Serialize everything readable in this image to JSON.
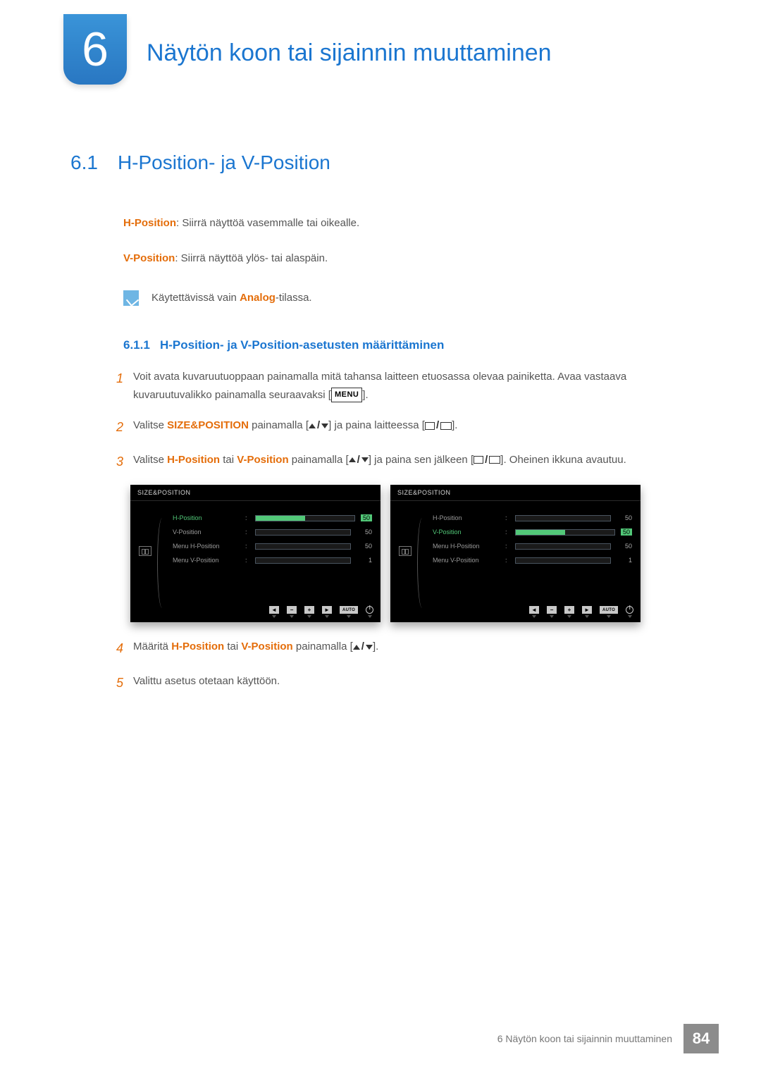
{
  "chapter": {
    "number": "6",
    "title": "Näytön koon tai sijainnin muuttaminen"
  },
  "section": {
    "number": "6.1",
    "title": "H-Position- ja V-Position"
  },
  "definitions": {
    "h_label": "H-Position",
    "h_text": ": Siirrä näyttöä vasemmalle tai oikealle.",
    "v_label": "V-Position",
    "v_text": ": Siirrä näyttöä ylös- tai alaspäin."
  },
  "note": {
    "pre": "Käytettävissä vain ",
    "word": "Analog",
    "post": "-tilassa."
  },
  "subsection": {
    "number": "6.1.1",
    "title": "H-Position- ja V-Position-asetusten määrittäminen"
  },
  "steps": {
    "s1": "Voit avata kuvaruutuoppaan painamalla mitä tahansa laitteen etuosassa olevaa painiketta. Avaa vastaava kuvaruutuvalikko painamalla seuraavaksi [",
    "s1_menu": "MENU",
    "s1_end": "].",
    "s2a": "Valitse ",
    "s2_sp": "SIZE&POSITION",
    "s2b": " painamalla [",
    "s2c": "] ja paina laitteessa [",
    "s2d": "].",
    "s3a": "Valitse ",
    "s3_h": "H-Position",
    "s3_or": " tai ",
    "s3_v": "V-Position",
    "s3b": " painamalla [",
    "s3c": "] ja paina sen jälkeen [",
    "s3d": "]. Oheinen ikkuna avautuu.",
    "s4a": "Määritä ",
    "s4_h": "H-Position",
    "s4_or": " tai ",
    "s4_v": "V-Position",
    "s4b": " painamalla [",
    "s4c": "].",
    "s5": "Valittu asetus otetaan käyttöön."
  },
  "osd": {
    "title": "SIZE&POSITION",
    "rows": [
      {
        "label": "H-Position",
        "value": "50"
      },
      {
        "label": "V-Position",
        "value": "50"
      },
      {
        "label": "Menu H-Position",
        "value": "50"
      },
      {
        "label": "Menu V-Position",
        "value": "1"
      }
    ],
    "auto": "AUTO"
  },
  "footer": {
    "text": "6 Näytön koon tai sijainnin muuttaminen",
    "page": "84"
  }
}
